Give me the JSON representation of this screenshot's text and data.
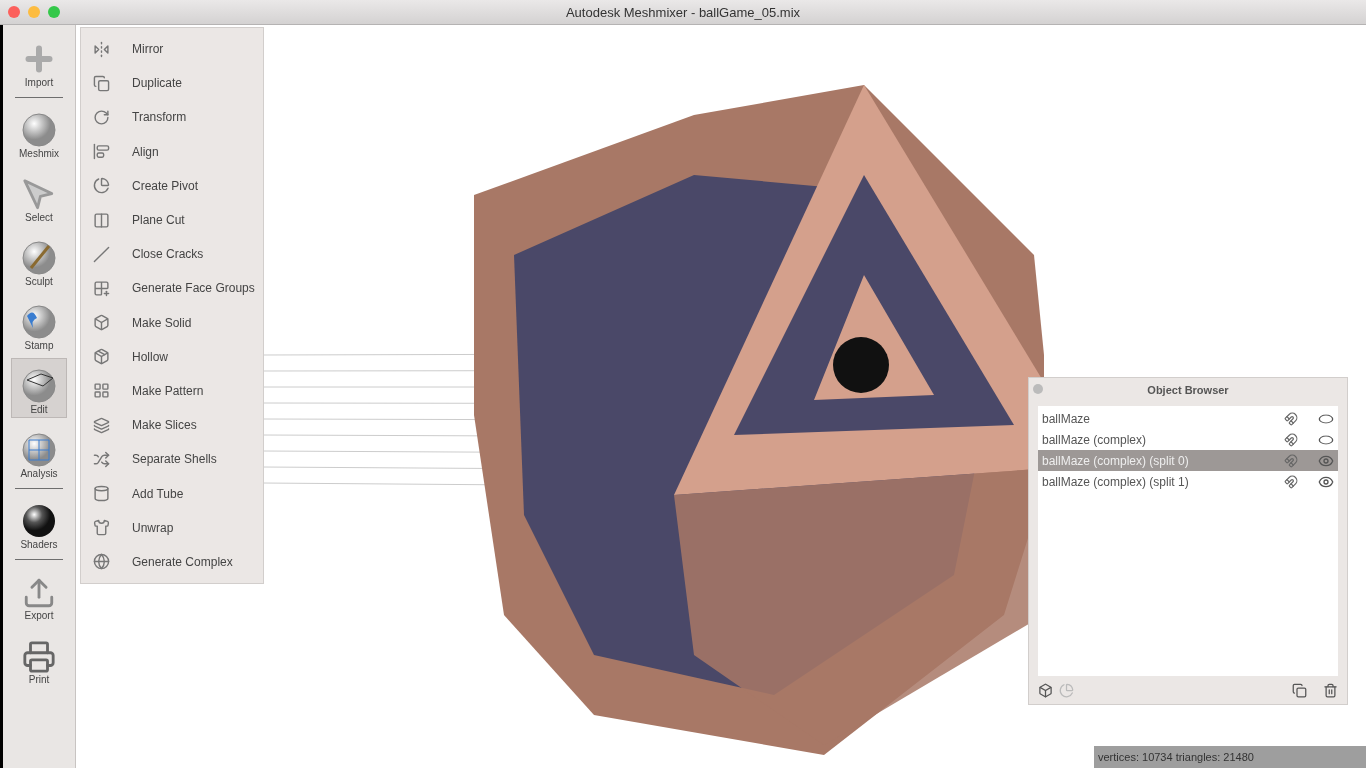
{
  "window": {
    "title": "Autodesk Meshmixer - ballGame_05.mix"
  },
  "toolbar": {
    "groups": [
      [
        {
          "label": "Import",
          "selected": false
        }
      ],
      [
        {
          "label": "Meshmix",
          "selected": false
        },
        {
          "label": "Select",
          "selected": false
        },
        {
          "label": "Sculpt",
          "selected": false
        },
        {
          "label": "Stamp",
          "selected": false
        },
        {
          "label": "Edit",
          "selected": true
        },
        {
          "label": "Analysis",
          "selected": false
        }
      ],
      [
        {
          "label": "Shaders",
          "selected": false
        }
      ],
      [
        {
          "label": "Export",
          "selected": false
        },
        {
          "label": "Print",
          "selected": false
        }
      ]
    ]
  },
  "edit_menu": {
    "items": [
      "Mirror",
      "Duplicate",
      "Transform",
      "Align",
      "Create Pivot",
      "Plane Cut",
      "Close Cracks",
      "Generate Face Groups",
      "Make Solid",
      "Hollow",
      "Make Pattern",
      "Make Slices",
      "Separate Shells",
      "Add Tube",
      "Unwrap",
      "Generate Complex"
    ]
  },
  "object_browser": {
    "title": "Object Browser",
    "objects": [
      {
        "name": "ballMaze",
        "selected": false,
        "visible": false
      },
      {
        "name": "ballMaze (complex)",
        "selected": false,
        "visible": false
      },
      {
        "name": "ballMaze (complex) (split 0)",
        "selected": true,
        "visible": true
      },
      {
        "name": "ballMaze (complex) (split 1)",
        "selected": false,
        "visible": true
      }
    ]
  },
  "status_bar": {
    "text": "vertices: 10734 triangles: 21480"
  }
}
